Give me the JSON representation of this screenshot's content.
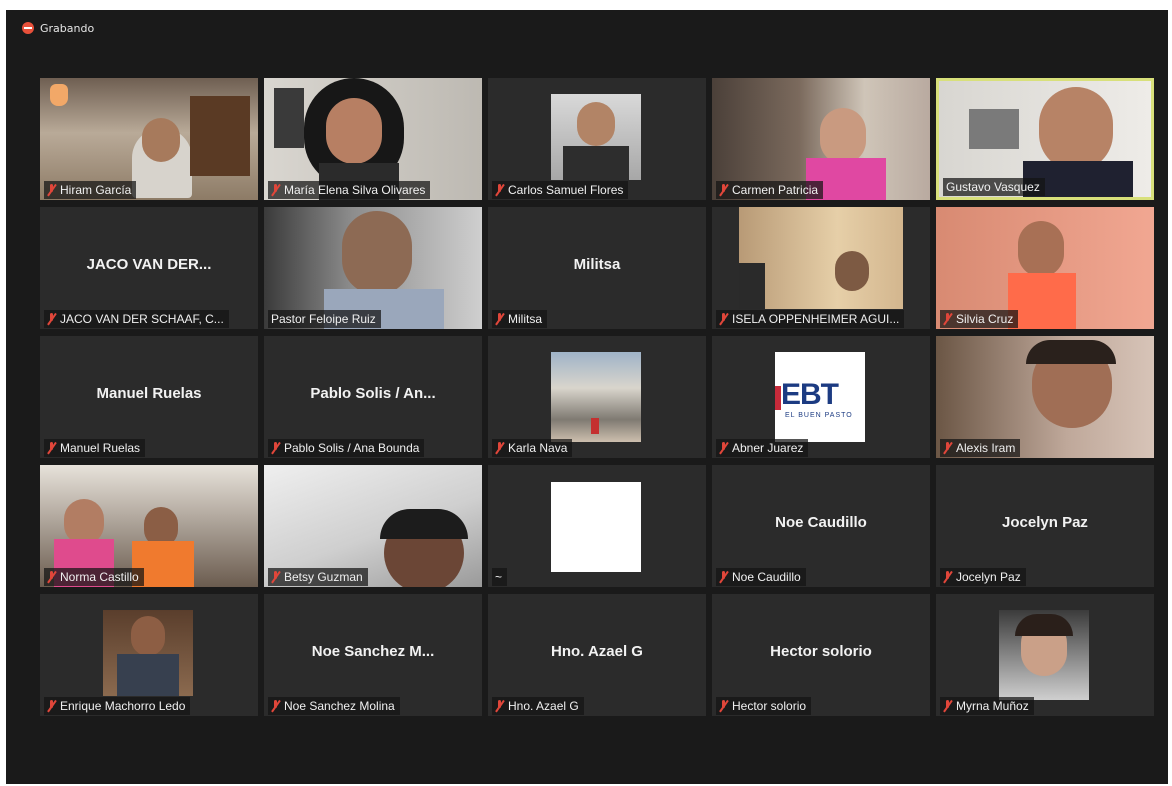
{
  "recording": {
    "label": "Grabando"
  },
  "participants": [
    {
      "name": "Hiram García",
      "muted": true
    },
    {
      "name": "María Elena Silva Olivares",
      "muted": true
    },
    {
      "name": "Carlos Samuel Flores",
      "muted": true
    },
    {
      "name": "Carmen Patricia",
      "muted": true
    },
    {
      "name": "Gustavo Vasquez",
      "muted": false,
      "active_speaker": true
    },
    {
      "name": "JACO VAN DER SCHAAF, C...",
      "display": "JACO VAN DER...",
      "muted": true
    },
    {
      "name": "Pastor Feloipe Ruiz",
      "muted": false
    },
    {
      "name": "Militsa",
      "display": "Militsa",
      "muted": true
    },
    {
      "name": "ISELA OPPENHEIMER AGUI...",
      "muted": true
    },
    {
      "name": "Silvia Cruz",
      "muted": true
    },
    {
      "name": "Manuel Ruelas",
      "display": "Manuel Ruelas",
      "muted": true
    },
    {
      "name": "Pablo Solis / Ana Bounda",
      "display": "Pablo Solis / An...",
      "muted": true
    },
    {
      "name": "Karla Nava",
      "muted": true
    },
    {
      "name": "Abner Juarez",
      "muted": true
    },
    {
      "name": "Alexis Iram",
      "muted": true
    },
    {
      "name": "Norma Castillo",
      "muted": true
    },
    {
      "name": "Betsy Guzman",
      "muted": true
    },
    {
      "name": "~",
      "muted": false
    },
    {
      "name": "Noe Caudillo",
      "display": "Noe Caudillo",
      "muted": true
    },
    {
      "name": "Jocelyn Paz",
      "display": "Jocelyn Paz",
      "muted": true
    },
    {
      "name": "Enrique Machorro Ledo",
      "muted": true
    },
    {
      "name": "Noe Sanchez Molina",
      "display": "Noe Sanchez M...",
      "muted": true
    },
    {
      "name": "Hno. Azael G",
      "display": "Hno. Azael G",
      "muted": true
    },
    {
      "name": "Hector solorio",
      "display": "Hector solorio",
      "muted": true
    },
    {
      "name": "Myrna Muñoz",
      "muted": true
    }
  ],
  "logo_text": {
    "main": "EBT",
    "sub": "EL BUEN PASTO"
  },
  "colors": {
    "background": "#1a1a1a",
    "tile": "#2b2b2b",
    "active_border": "#d8e07b",
    "muted_icon": "#e0463a",
    "recording": "#e8503a"
  },
  "icons": {
    "recording": "record-dot-icon",
    "muted": "mic-muted-icon",
    "raised_hand": "raised-hand-icon"
  }
}
